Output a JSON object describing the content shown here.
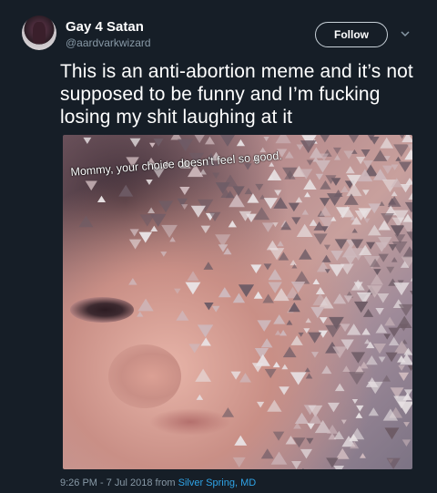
{
  "tweet": {
    "display_name": "Gay 4 Satan",
    "handle": "@aardvarkwizard",
    "follow_label": "Follow",
    "text": "This is an anti-abortion meme and it’s not supposed to be funny and I’m fucking losing my shit laughing at it",
    "media_caption": "Mommy, your choice doesn't feel so good.",
    "timestamp": "9:26 PM - 7 Jul 2018 from",
    "location": "Silver Spring, MD"
  },
  "icons": {
    "more": "chevron-down-icon"
  },
  "colors": {
    "background": "#161e27",
    "secondary_text": "#8899a6",
    "link": "#2fa4e7"
  }
}
